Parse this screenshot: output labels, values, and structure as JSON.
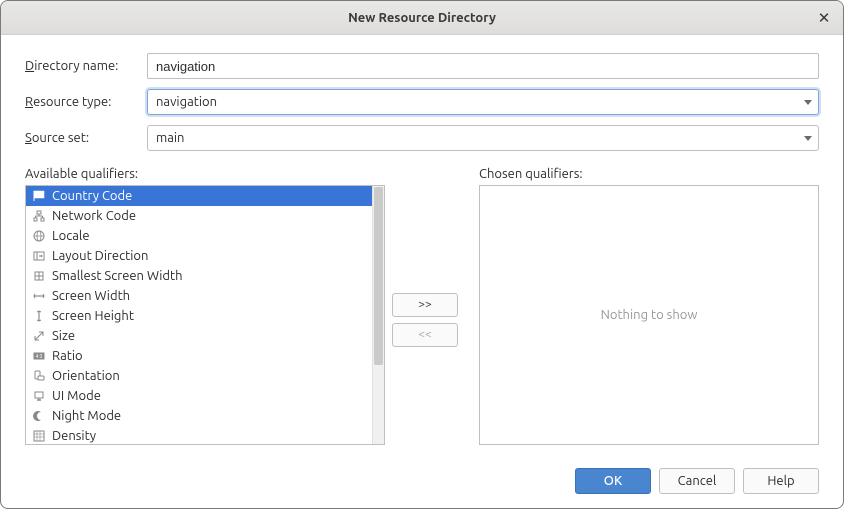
{
  "title": "New Resource Directory",
  "labels": {
    "directory_name": "Directory name:",
    "resource_type": "Resource type:",
    "source_set": "Source set:",
    "available_qualifiers": "Available qualifiers:",
    "chosen_qualifiers": "Chosen qualifiers:"
  },
  "fields": {
    "directory_name": "navigation",
    "resource_type": "navigation",
    "source_set": "main"
  },
  "qualifiers": [
    {
      "label": "Country Code",
      "icon": "flag"
    },
    {
      "label": "Network Code",
      "icon": "network"
    },
    {
      "label": "Locale",
      "icon": "globe"
    },
    {
      "label": "Layout Direction",
      "icon": "layout-dir"
    },
    {
      "label": "Smallest Screen Width",
      "icon": "smallest-width"
    },
    {
      "label": "Screen Width",
      "icon": "screen-width"
    },
    {
      "label": "Screen Height",
      "icon": "screen-height"
    },
    {
      "label": "Size",
      "icon": "size"
    },
    {
      "label": "Ratio",
      "icon": "ratio"
    },
    {
      "label": "Orientation",
      "icon": "orientation"
    },
    {
      "label": "UI Mode",
      "icon": "ui-mode"
    },
    {
      "label": "Night Mode",
      "icon": "night"
    },
    {
      "label": "Density",
      "icon": "density"
    }
  ],
  "selected_index": 0,
  "chosen_empty_text": "Nothing to show",
  "buttons": {
    "add": ">>",
    "remove": "<<",
    "ok": "OK",
    "cancel": "Cancel",
    "help": "Help"
  }
}
